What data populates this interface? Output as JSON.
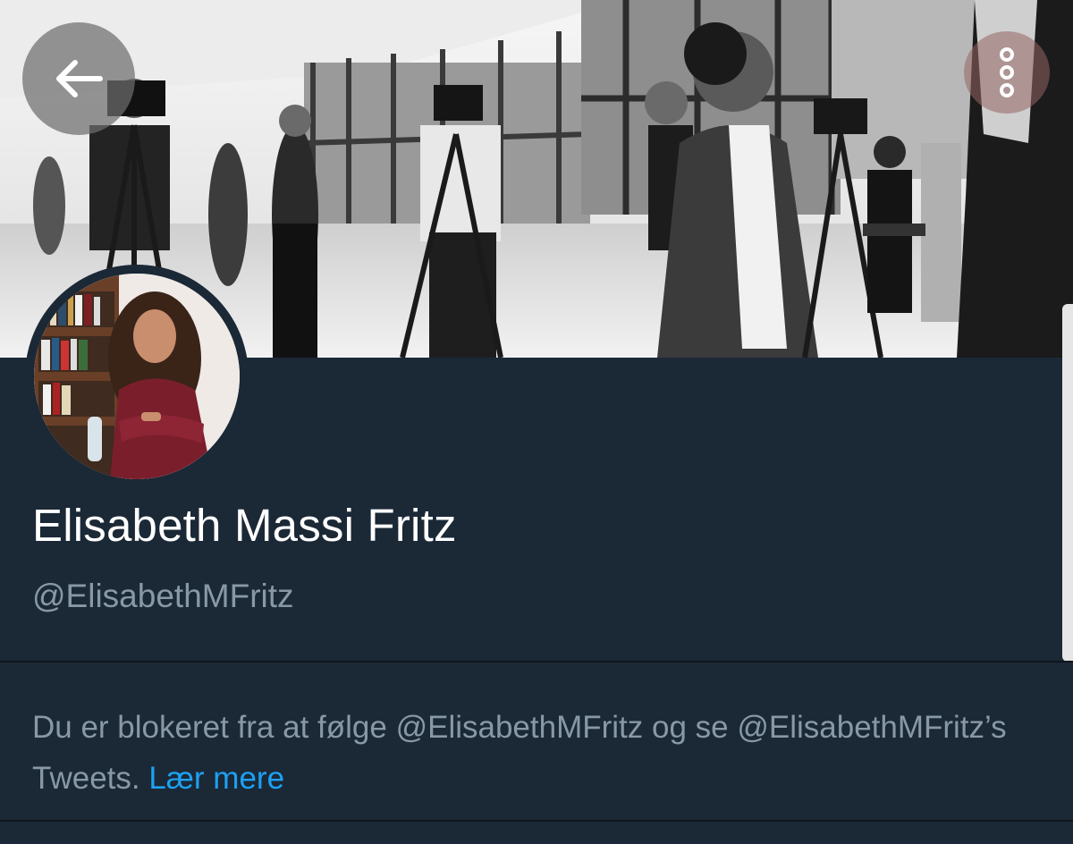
{
  "profile": {
    "display_name": "Elisabeth Massi Fritz",
    "handle": "@ElisabethMFritz"
  },
  "notice": {
    "blocked_text": "Du er blokeret fra at følge @ElisabethMFritz og se @ElisabethMFritz’s Tweets.",
    "learn_more": "Lær mere"
  },
  "icons": {
    "back": "arrow-left-icon",
    "more": "more-vertical-icon"
  },
  "colors": {
    "background": "#1b2836",
    "primary_text": "#ffffff",
    "secondary_text": "#8899a6",
    "link": "#1da1f2"
  }
}
